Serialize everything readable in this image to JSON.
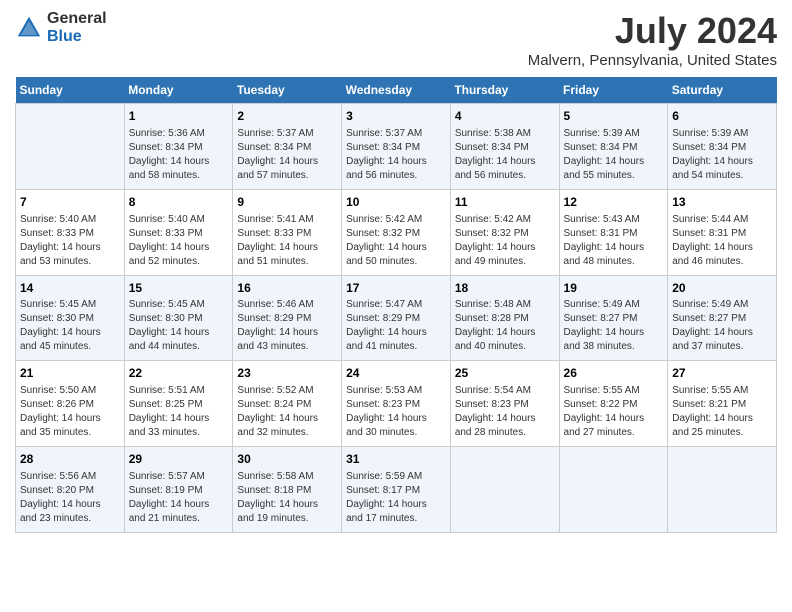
{
  "logo": {
    "general": "General",
    "blue": "Blue"
  },
  "title": "July 2024",
  "subtitle": "Malvern, Pennsylvania, United States",
  "headers": [
    "Sunday",
    "Monday",
    "Tuesday",
    "Wednesday",
    "Thursday",
    "Friday",
    "Saturday"
  ],
  "weeks": [
    [
      {
        "day": "",
        "info": ""
      },
      {
        "day": "1",
        "info": "Sunrise: 5:36 AM\nSunset: 8:34 PM\nDaylight: 14 hours\nand 58 minutes."
      },
      {
        "day": "2",
        "info": "Sunrise: 5:37 AM\nSunset: 8:34 PM\nDaylight: 14 hours\nand 57 minutes."
      },
      {
        "day": "3",
        "info": "Sunrise: 5:37 AM\nSunset: 8:34 PM\nDaylight: 14 hours\nand 56 minutes."
      },
      {
        "day": "4",
        "info": "Sunrise: 5:38 AM\nSunset: 8:34 PM\nDaylight: 14 hours\nand 56 minutes."
      },
      {
        "day": "5",
        "info": "Sunrise: 5:39 AM\nSunset: 8:34 PM\nDaylight: 14 hours\nand 55 minutes."
      },
      {
        "day": "6",
        "info": "Sunrise: 5:39 AM\nSunset: 8:34 PM\nDaylight: 14 hours\nand 54 minutes."
      }
    ],
    [
      {
        "day": "7",
        "info": "Sunrise: 5:40 AM\nSunset: 8:33 PM\nDaylight: 14 hours\nand 53 minutes."
      },
      {
        "day": "8",
        "info": "Sunrise: 5:40 AM\nSunset: 8:33 PM\nDaylight: 14 hours\nand 52 minutes."
      },
      {
        "day": "9",
        "info": "Sunrise: 5:41 AM\nSunset: 8:33 PM\nDaylight: 14 hours\nand 51 minutes."
      },
      {
        "day": "10",
        "info": "Sunrise: 5:42 AM\nSunset: 8:32 PM\nDaylight: 14 hours\nand 50 minutes."
      },
      {
        "day": "11",
        "info": "Sunrise: 5:42 AM\nSunset: 8:32 PM\nDaylight: 14 hours\nand 49 minutes."
      },
      {
        "day": "12",
        "info": "Sunrise: 5:43 AM\nSunset: 8:31 PM\nDaylight: 14 hours\nand 48 minutes."
      },
      {
        "day": "13",
        "info": "Sunrise: 5:44 AM\nSunset: 8:31 PM\nDaylight: 14 hours\nand 46 minutes."
      }
    ],
    [
      {
        "day": "14",
        "info": "Sunrise: 5:45 AM\nSunset: 8:30 PM\nDaylight: 14 hours\nand 45 minutes."
      },
      {
        "day": "15",
        "info": "Sunrise: 5:45 AM\nSunset: 8:30 PM\nDaylight: 14 hours\nand 44 minutes."
      },
      {
        "day": "16",
        "info": "Sunrise: 5:46 AM\nSunset: 8:29 PM\nDaylight: 14 hours\nand 43 minutes."
      },
      {
        "day": "17",
        "info": "Sunrise: 5:47 AM\nSunset: 8:29 PM\nDaylight: 14 hours\nand 41 minutes."
      },
      {
        "day": "18",
        "info": "Sunrise: 5:48 AM\nSunset: 8:28 PM\nDaylight: 14 hours\nand 40 minutes."
      },
      {
        "day": "19",
        "info": "Sunrise: 5:49 AM\nSunset: 8:27 PM\nDaylight: 14 hours\nand 38 minutes."
      },
      {
        "day": "20",
        "info": "Sunrise: 5:49 AM\nSunset: 8:27 PM\nDaylight: 14 hours\nand 37 minutes."
      }
    ],
    [
      {
        "day": "21",
        "info": "Sunrise: 5:50 AM\nSunset: 8:26 PM\nDaylight: 14 hours\nand 35 minutes."
      },
      {
        "day": "22",
        "info": "Sunrise: 5:51 AM\nSunset: 8:25 PM\nDaylight: 14 hours\nand 33 minutes."
      },
      {
        "day": "23",
        "info": "Sunrise: 5:52 AM\nSunset: 8:24 PM\nDaylight: 14 hours\nand 32 minutes."
      },
      {
        "day": "24",
        "info": "Sunrise: 5:53 AM\nSunset: 8:23 PM\nDaylight: 14 hours\nand 30 minutes."
      },
      {
        "day": "25",
        "info": "Sunrise: 5:54 AM\nSunset: 8:23 PM\nDaylight: 14 hours\nand 28 minutes."
      },
      {
        "day": "26",
        "info": "Sunrise: 5:55 AM\nSunset: 8:22 PM\nDaylight: 14 hours\nand 27 minutes."
      },
      {
        "day": "27",
        "info": "Sunrise: 5:55 AM\nSunset: 8:21 PM\nDaylight: 14 hours\nand 25 minutes."
      }
    ],
    [
      {
        "day": "28",
        "info": "Sunrise: 5:56 AM\nSunset: 8:20 PM\nDaylight: 14 hours\nand 23 minutes."
      },
      {
        "day": "29",
        "info": "Sunrise: 5:57 AM\nSunset: 8:19 PM\nDaylight: 14 hours\nand 21 minutes."
      },
      {
        "day": "30",
        "info": "Sunrise: 5:58 AM\nSunset: 8:18 PM\nDaylight: 14 hours\nand 19 minutes."
      },
      {
        "day": "31",
        "info": "Sunrise: 5:59 AM\nSunset: 8:17 PM\nDaylight: 14 hours\nand 17 minutes."
      },
      {
        "day": "",
        "info": ""
      },
      {
        "day": "",
        "info": ""
      },
      {
        "day": "",
        "info": ""
      }
    ]
  ]
}
